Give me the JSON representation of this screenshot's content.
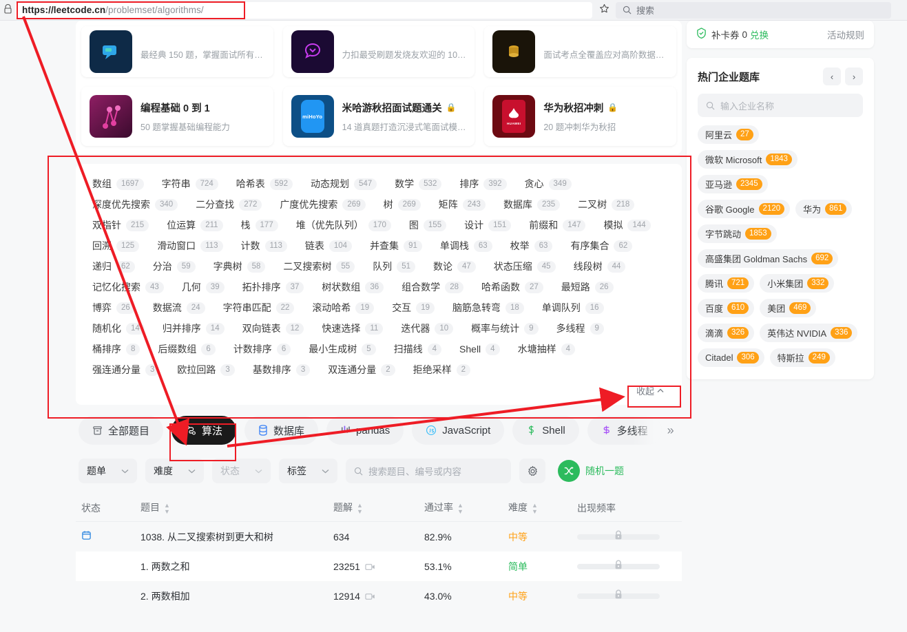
{
  "browser": {
    "lock_icon": "lock-icon",
    "url_host": "https://leetcode.cn",
    "url_path": "/problemset/algorithms/",
    "star_icon": "star-icon",
    "search_placeholder": "搜索"
  },
  "study_plans_row1": [
    {
      "title": "",
      "subtitle": "最经典 150 题，掌握面试所有…",
      "icon_bg": "#0e2a47"
    },
    {
      "title": "",
      "subtitle": "力扣最受刷题发烧友欢迎的 10…",
      "icon_bg": "#1b0a33"
    },
    {
      "title": "",
      "subtitle": "面试考点全覆盖应对高阶数据…",
      "icon_bg": "#1a1409"
    }
  ],
  "study_plans_row2": [
    {
      "title": "编程基础 0 到 1",
      "subtitle": "50 题掌握基础编程能力",
      "locked": false,
      "icon_bg": "#7c1f5c",
      "icon_text": ""
    },
    {
      "title": "米哈游秋招面试题通关",
      "subtitle": "14 道真题打造沉浸式笔面试模…",
      "locked": true,
      "icon_bg": "#0f5ea8",
      "icon_text": "miHoYo"
    },
    {
      "title": "华为秋招冲刺",
      "subtitle": "20 题冲刺华为秋招",
      "locked": true,
      "icon_bg": "#8b0d16",
      "icon_text": "HUAWEI"
    }
  ],
  "topic_tags": [
    {
      "label": "数组",
      "count": "1697"
    },
    {
      "label": "字符串",
      "count": "724"
    },
    {
      "label": "哈希表",
      "count": "592"
    },
    {
      "label": "动态规划",
      "count": "547"
    },
    {
      "label": "数学",
      "count": "532"
    },
    {
      "label": "排序",
      "count": "392"
    },
    {
      "label": "贪心",
      "count": "349"
    },
    {
      "label": "深度优先搜索",
      "count": "340"
    },
    {
      "label": "二分查找",
      "count": "272"
    },
    {
      "label": "广度优先搜索",
      "count": "269"
    },
    {
      "label": "树",
      "count": "269"
    },
    {
      "label": "矩阵",
      "count": "243"
    },
    {
      "label": "数据库",
      "count": "235"
    },
    {
      "label": "二叉树",
      "count": "218"
    },
    {
      "label": "双指针",
      "count": "215"
    },
    {
      "label": "位运算",
      "count": "211"
    },
    {
      "label": "栈",
      "count": "177"
    },
    {
      "label": "堆（优先队列）",
      "count": "170"
    },
    {
      "label": "图",
      "count": "155"
    },
    {
      "label": "设计",
      "count": "151"
    },
    {
      "label": "前缀和",
      "count": "147"
    },
    {
      "label": "模拟",
      "count": "144"
    },
    {
      "label": "回溯",
      "count": "125"
    },
    {
      "label": "滑动窗口",
      "count": "113"
    },
    {
      "label": "计数",
      "count": "113"
    },
    {
      "label": "链表",
      "count": "104"
    },
    {
      "label": "并查集",
      "count": "91"
    },
    {
      "label": "单调栈",
      "count": "63"
    },
    {
      "label": "枚举",
      "count": "63"
    },
    {
      "label": "有序集合",
      "count": "62"
    },
    {
      "label": "递归",
      "count": "62"
    },
    {
      "label": "分治",
      "count": "59"
    },
    {
      "label": "字典树",
      "count": "58"
    },
    {
      "label": "二叉搜索树",
      "count": "55"
    },
    {
      "label": "队列",
      "count": "51"
    },
    {
      "label": "数论",
      "count": "47"
    },
    {
      "label": "状态压缩",
      "count": "45"
    },
    {
      "label": "线段树",
      "count": "44"
    },
    {
      "label": "记忆化搜索",
      "count": "43"
    },
    {
      "label": "几何",
      "count": "39"
    },
    {
      "label": "拓扑排序",
      "count": "37"
    },
    {
      "label": "树状数组",
      "count": "36"
    },
    {
      "label": "组合数学",
      "count": "28"
    },
    {
      "label": "哈希函数",
      "count": "27"
    },
    {
      "label": "最短路",
      "count": "26"
    },
    {
      "label": "博弈",
      "count": "26"
    },
    {
      "label": "数据流",
      "count": "24"
    },
    {
      "label": "字符串匹配",
      "count": "22"
    },
    {
      "label": "滚动哈希",
      "count": "19"
    },
    {
      "label": "交互",
      "count": "19"
    },
    {
      "label": "脑筋急转弯",
      "count": "18"
    },
    {
      "label": "单调队列",
      "count": "16"
    },
    {
      "label": "随机化",
      "count": "14"
    },
    {
      "label": "归并排序",
      "count": "14"
    },
    {
      "label": "双向链表",
      "count": "12"
    },
    {
      "label": "快速选择",
      "count": "11"
    },
    {
      "label": "迭代器",
      "count": "10"
    },
    {
      "label": "概率与统计",
      "count": "9"
    },
    {
      "label": "多线程",
      "count": "9"
    },
    {
      "label": "桶排序",
      "count": "8"
    },
    {
      "label": "后缀数组",
      "count": "6"
    },
    {
      "label": "计数排序",
      "count": "6"
    },
    {
      "label": "最小生成树",
      "count": "5"
    },
    {
      "label": "扫描线",
      "count": "4"
    },
    {
      "label": "Shell",
      "count": "4"
    },
    {
      "label": "水塘抽样",
      "count": "4"
    },
    {
      "label": "强连通分量",
      "count": "3"
    },
    {
      "label": "欧拉回路",
      "count": "3"
    },
    {
      "label": "基数排序",
      "count": "3"
    },
    {
      "label": "双连通分量",
      "count": "2"
    },
    {
      "label": "拒绝采样",
      "count": "2"
    }
  ],
  "collapse_button": {
    "label": "收起",
    "icon": "chevron-up-icon"
  },
  "category_chips": [
    {
      "label": "全部题目",
      "icon": "all-problems-icon",
      "active": false,
      "color": "#5c6168"
    },
    {
      "label": "算法",
      "icon": "algorithm-icon",
      "active": true,
      "color": "#ffffff"
    },
    {
      "label": "数据库",
      "icon": "database-icon",
      "active": false,
      "color": "#3b82f6"
    },
    {
      "label": "pandas",
      "icon": "pandas-icon",
      "active": false,
      "color": "#6b7280"
    },
    {
      "label": "JavaScript",
      "icon": "javascript-icon",
      "active": false,
      "color": "#38bdf8"
    },
    {
      "label": "Shell",
      "icon": "shell-icon",
      "active": false,
      "color": "#2cbb5d"
    },
    {
      "label": "多线程",
      "icon": "concurrency-icon",
      "active": false,
      "color": "#a855f7"
    }
  ],
  "chips_overflow_icon": "chevron-double-right-icon",
  "filters": {
    "list": {
      "label": "题单",
      "icon": "chevron-down-icon"
    },
    "difficulty": {
      "label": "难度",
      "icon": "chevron-down-icon"
    },
    "status": {
      "label": "状态",
      "icon": "chevron-down-icon"
    },
    "tags": {
      "label": "标签",
      "icon": "chevron-down-icon"
    },
    "search_placeholder": "搜索题目、编号或内容",
    "search_icon": "search-icon",
    "settings_icon": "gear-icon",
    "random": {
      "label": "随机一题",
      "icon": "shuffle-icon",
      "color": "#2cbb5d"
    }
  },
  "table": {
    "headers": [
      {
        "label": "状态",
        "sortable": false
      },
      {
        "label": "题目",
        "sortable": true
      },
      {
        "label": "题解",
        "sortable": true
      },
      {
        "label": "通过率",
        "sortable": true
      },
      {
        "label": "难度",
        "sortable": true
      },
      {
        "label": "出现频率",
        "sortable": false
      }
    ],
    "rows": [
      {
        "status_icon": "calendar-icon",
        "title": "1038. 从二叉搜索树到更大和树",
        "solutions": "634",
        "has_video": false,
        "rate": "82.9%",
        "difficulty": "中等",
        "difficulty_class": "d-medium",
        "freq_locked": true
      },
      {
        "status_icon": "",
        "title": "1. 两数之和",
        "solutions": "23251",
        "has_video": true,
        "rate": "53.1%",
        "difficulty": "简单",
        "difficulty_class": "d-easy",
        "freq_locked": true
      },
      {
        "status_icon": "",
        "title": "2. 两数相加",
        "solutions": "12914",
        "has_video": true,
        "rate": "43.0%",
        "difficulty": "中等",
        "difficulty_class": "d-medium",
        "freq_locked": true
      }
    ]
  },
  "sidebar": {
    "coupon": {
      "icon": "shield-check-icon",
      "label": "补卡券",
      "count": "0",
      "redeem": "兑换",
      "rules": "活动规则"
    },
    "companies": {
      "title": "热门企业题库",
      "prev_icon": "chevron-left-icon",
      "next_icon": "chevron-right-icon",
      "search_placeholder": "输入企业名称",
      "search_icon": "search-icon",
      "tags": [
        {
          "label": "阿里云",
          "count": "27"
        },
        {
          "label": "微软 Microsoft",
          "count": "1843"
        },
        {
          "label": "亚马逊",
          "count": "2345"
        },
        {
          "label": "谷歌 Google",
          "count": "2120"
        },
        {
          "label": "华为",
          "count": "861"
        },
        {
          "label": "字节跳动",
          "count": "1853"
        },
        {
          "label": "高盛集团 Goldman Sachs",
          "count": "692"
        },
        {
          "label": "腾讯",
          "count": "721"
        },
        {
          "label": "小米集团",
          "count": "332"
        },
        {
          "label": "百度",
          "count": "610"
        },
        {
          "label": "美团",
          "count": "469"
        },
        {
          "label": "滴滴",
          "count": "326"
        },
        {
          "label": "英伟达 NVIDIA",
          "count": "336"
        },
        {
          "label": "Citadel",
          "count": "306"
        },
        {
          "label": "特斯拉",
          "count": "249"
        }
      ]
    }
  },
  "annotation": {
    "color": "#ee1c25",
    "boxes": [
      "url-bar-highlight",
      "tag-cloud-highlight",
      "algorithm-chip-highlight",
      "collapse-button-highlight"
    ],
    "arrows": [
      "url-to-algorithm-chip",
      "algorithm-chip-to-collapse"
    ]
  }
}
